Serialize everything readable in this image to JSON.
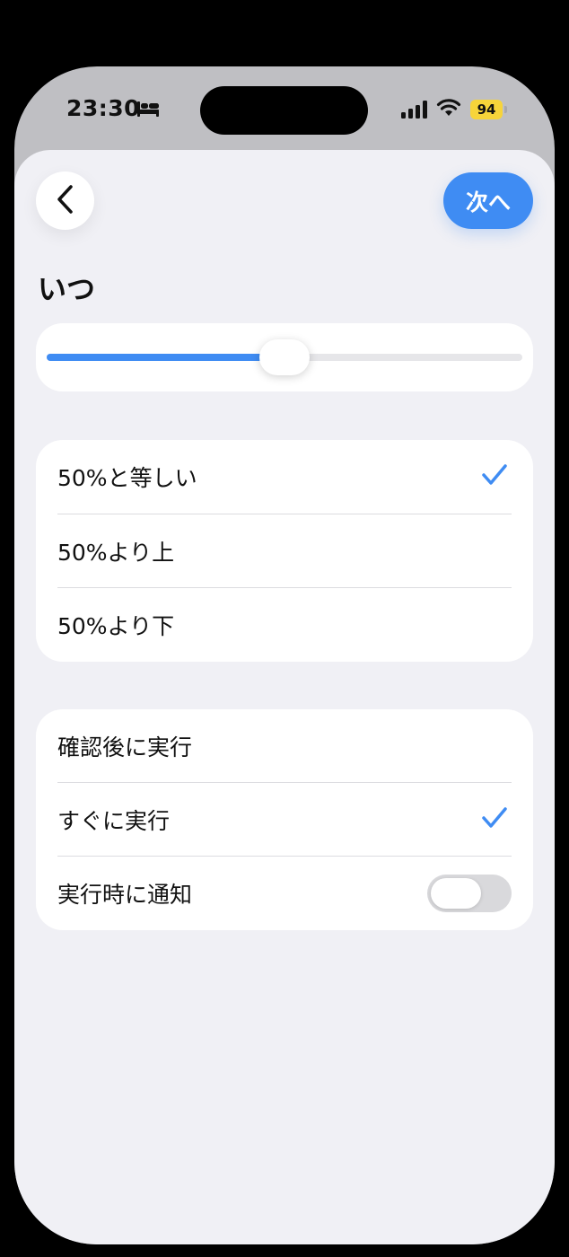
{
  "status_bar": {
    "time": "23:30",
    "focus_icon": "bed-icon",
    "battery_level": "94"
  },
  "header": {
    "back_icon": "chevron-left-icon",
    "next_label": "次へ"
  },
  "when": {
    "title": "いつ",
    "slider_value_percent": 50
  },
  "condition_options": [
    {
      "label": "50%と等しい",
      "selected": true
    },
    {
      "label": "50%より上",
      "selected": false
    },
    {
      "label": "50%より下",
      "selected": false
    }
  ],
  "run_options": [
    {
      "label": "確認後に実行",
      "selected": false
    },
    {
      "label": "すぐに実行",
      "selected": true
    },
    {
      "label": "実行時に通知",
      "toggle_on": false
    }
  ],
  "colors": {
    "accent": "#3f8cf3",
    "battery": "#f7d43a",
    "sheet_background": "#f0f0f5"
  }
}
